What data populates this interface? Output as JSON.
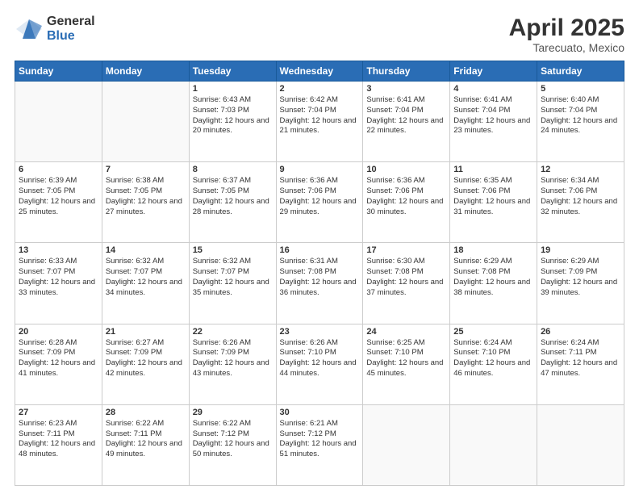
{
  "header": {
    "logo_line1": "General",
    "logo_line2": "Blue",
    "main_title": "April 2025",
    "subtitle": "Tarecuato, Mexico"
  },
  "days_of_week": [
    "Sunday",
    "Monday",
    "Tuesday",
    "Wednesday",
    "Thursday",
    "Friday",
    "Saturday"
  ],
  "weeks": [
    [
      {
        "day": "",
        "info": ""
      },
      {
        "day": "",
        "info": ""
      },
      {
        "day": "1",
        "info": "Sunrise: 6:43 AM\nSunset: 7:03 PM\nDaylight: 12 hours and 20 minutes."
      },
      {
        "day": "2",
        "info": "Sunrise: 6:42 AM\nSunset: 7:04 PM\nDaylight: 12 hours and 21 minutes."
      },
      {
        "day": "3",
        "info": "Sunrise: 6:41 AM\nSunset: 7:04 PM\nDaylight: 12 hours and 22 minutes."
      },
      {
        "day": "4",
        "info": "Sunrise: 6:41 AM\nSunset: 7:04 PM\nDaylight: 12 hours and 23 minutes."
      },
      {
        "day": "5",
        "info": "Sunrise: 6:40 AM\nSunset: 7:04 PM\nDaylight: 12 hours and 24 minutes."
      }
    ],
    [
      {
        "day": "6",
        "info": "Sunrise: 6:39 AM\nSunset: 7:05 PM\nDaylight: 12 hours and 25 minutes."
      },
      {
        "day": "7",
        "info": "Sunrise: 6:38 AM\nSunset: 7:05 PM\nDaylight: 12 hours and 27 minutes."
      },
      {
        "day": "8",
        "info": "Sunrise: 6:37 AM\nSunset: 7:05 PM\nDaylight: 12 hours and 28 minutes."
      },
      {
        "day": "9",
        "info": "Sunrise: 6:36 AM\nSunset: 7:06 PM\nDaylight: 12 hours and 29 minutes."
      },
      {
        "day": "10",
        "info": "Sunrise: 6:36 AM\nSunset: 7:06 PM\nDaylight: 12 hours and 30 minutes."
      },
      {
        "day": "11",
        "info": "Sunrise: 6:35 AM\nSunset: 7:06 PM\nDaylight: 12 hours and 31 minutes."
      },
      {
        "day": "12",
        "info": "Sunrise: 6:34 AM\nSunset: 7:06 PM\nDaylight: 12 hours and 32 minutes."
      }
    ],
    [
      {
        "day": "13",
        "info": "Sunrise: 6:33 AM\nSunset: 7:07 PM\nDaylight: 12 hours and 33 minutes."
      },
      {
        "day": "14",
        "info": "Sunrise: 6:32 AM\nSunset: 7:07 PM\nDaylight: 12 hours and 34 minutes."
      },
      {
        "day": "15",
        "info": "Sunrise: 6:32 AM\nSunset: 7:07 PM\nDaylight: 12 hours and 35 minutes."
      },
      {
        "day": "16",
        "info": "Sunrise: 6:31 AM\nSunset: 7:08 PM\nDaylight: 12 hours and 36 minutes."
      },
      {
        "day": "17",
        "info": "Sunrise: 6:30 AM\nSunset: 7:08 PM\nDaylight: 12 hours and 37 minutes."
      },
      {
        "day": "18",
        "info": "Sunrise: 6:29 AM\nSunset: 7:08 PM\nDaylight: 12 hours and 38 minutes."
      },
      {
        "day": "19",
        "info": "Sunrise: 6:29 AM\nSunset: 7:09 PM\nDaylight: 12 hours and 39 minutes."
      }
    ],
    [
      {
        "day": "20",
        "info": "Sunrise: 6:28 AM\nSunset: 7:09 PM\nDaylight: 12 hours and 41 minutes."
      },
      {
        "day": "21",
        "info": "Sunrise: 6:27 AM\nSunset: 7:09 PM\nDaylight: 12 hours and 42 minutes."
      },
      {
        "day": "22",
        "info": "Sunrise: 6:26 AM\nSunset: 7:09 PM\nDaylight: 12 hours and 43 minutes."
      },
      {
        "day": "23",
        "info": "Sunrise: 6:26 AM\nSunset: 7:10 PM\nDaylight: 12 hours and 44 minutes."
      },
      {
        "day": "24",
        "info": "Sunrise: 6:25 AM\nSunset: 7:10 PM\nDaylight: 12 hours and 45 minutes."
      },
      {
        "day": "25",
        "info": "Sunrise: 6:24 AM\nSunset: 7:10 PM\nDaylight: 12 hours and 46 minutes."
      },
      {
        "day": "26",
        "info": "Sunrise: 6:24 AM\nSunset: 7:11 PM\nDaylight: 12 hours and 47 minutes."
      }
    ],
    [
      {
        "day": "27",
        "info": "Sunrise: 6:23 AM\nSunset: 7:11 PM\nDaylight: 12 hours and 48 minutes."
      },
      {
        "day": "28",
        "info": "Sunrise: 6:22 AM\nSunset: 7:11 PM\nDaylight: 12 hours and 49 minutes."
      },
      {
        "day": "29",
        "info": "Sunrise: 6:22 AM\nSunset: 7:12 PM\nDaylight: 12 hours and 50 minutes."
      },
      {
        "day": "30",
        "info": "Sunrise: 6:21 AM\nSunset: 7:12 PM\nDaylight: 12 hours and 51 minutes."
      },
      {
        "day": "",
        "info": ""
      },
      {
        "day": "",
        "info": ""
      },
      {
        "day": "",
        "info": ""
      }
    ]
  ]
}
